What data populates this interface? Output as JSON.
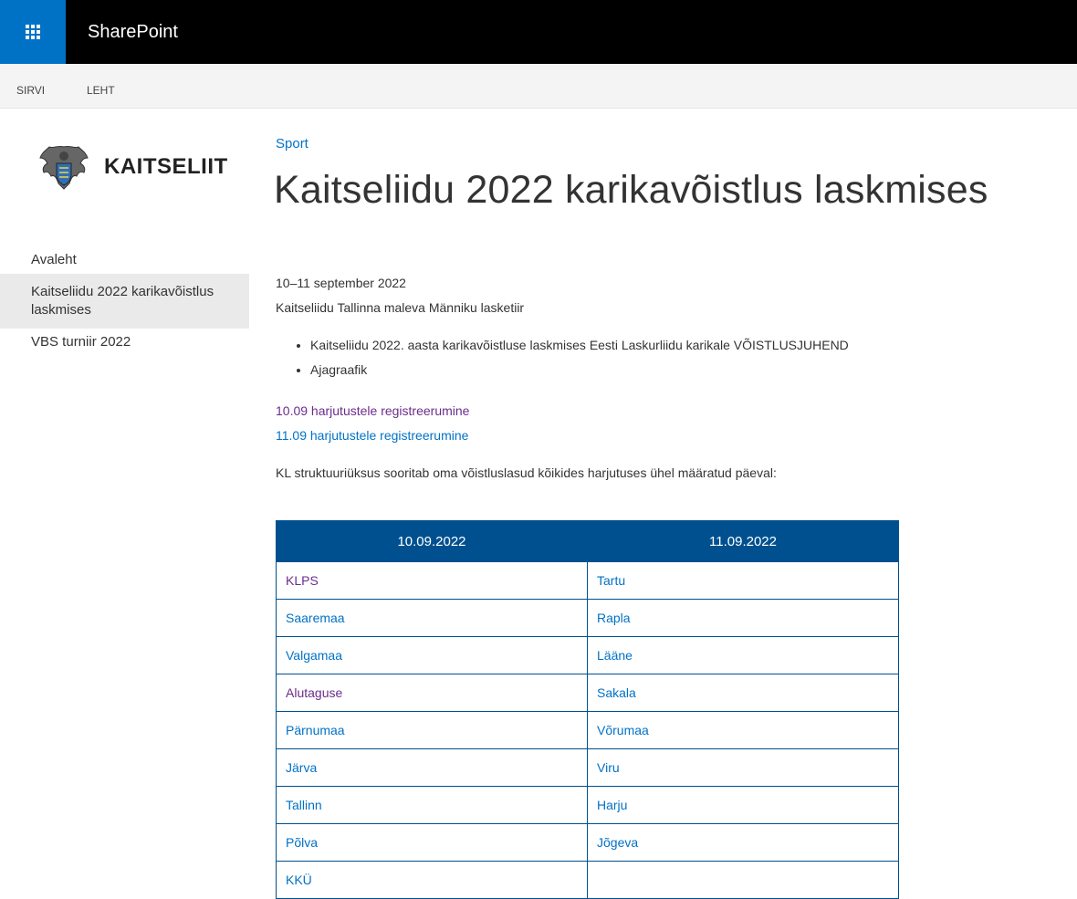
{
  "app": {
    "title": "SharePoint"
  },
  "ribbon": {
    "tabs": [
      "SIRVI",
      "LEHT"
    ]
  },
  "logo": {
    "text": "KAITSELIIT"
  },
  "leftnav": {
    "items": [
      {
        "label": "Avaleht",
        "selected": false
      },
      {
        "label": "Kaitseliidu 2022 karikavõistlus laskmises",
        "selected": true
      },
      {
        "label": "VBS turniir 2022",
        "selected": false
      }
    ]
  },
  "breadcrumb": {
    "site": "Sport"
  },
  "page": {
    "title": "Kaitseliidu 2022 karikavõistlus laskmises",
    "date": "10–11 september 2022",
    "venue": "Kaitseliidu Tallinna maleva Männiku lasketiir",
    "bullets": [
      "Kaitseliidu 2022. aasta karikavõistluse laskmises Eesti Laskurliidu karikale VÕISTLUSJUHEND",
      "Ajagraafik"
    ],
    "registration_links": [
      "10.09 harjutustele registreerumine",
      "11.09 harjutustele registreerumine"
    ],
    "intro": "KL struktuuriüksus sooritab oma võistluslasud kõikides harjutuses ühel määratud päeval:"
  },
  "schedule": {
    "headers": [
      "10.09.2022",
      "11.09.2022"
    ],
    "rows": [
      [
        "KLPS",
        "Tartu"
      ],
      [
        "Saaremaa",
        "Rapla"
      ],
      [
        "Valgamaa",
        "Lääne"
      ],
      [
        "Alutaguse",
        "Sakala"
      ],
      [
        "Pärnumaa",
        "Võrumaa"
      ],
      [
        "Järva",
        "Viru"
      ],
      [
        "Tallinn",
        "Harju"
      ],
      [
        "Põlva",
        "Jõgeva"
      ],
      [
        "KKÜ",
        ""
      ]
    ]
  },
  "colors": {
    "suitebar": "#000000",
    "waffle": "#0072c6",
    "link": "#0072c6",
    "visited_link": "#6b2d8c",
    "table_header": "#00508f"
  }
}
